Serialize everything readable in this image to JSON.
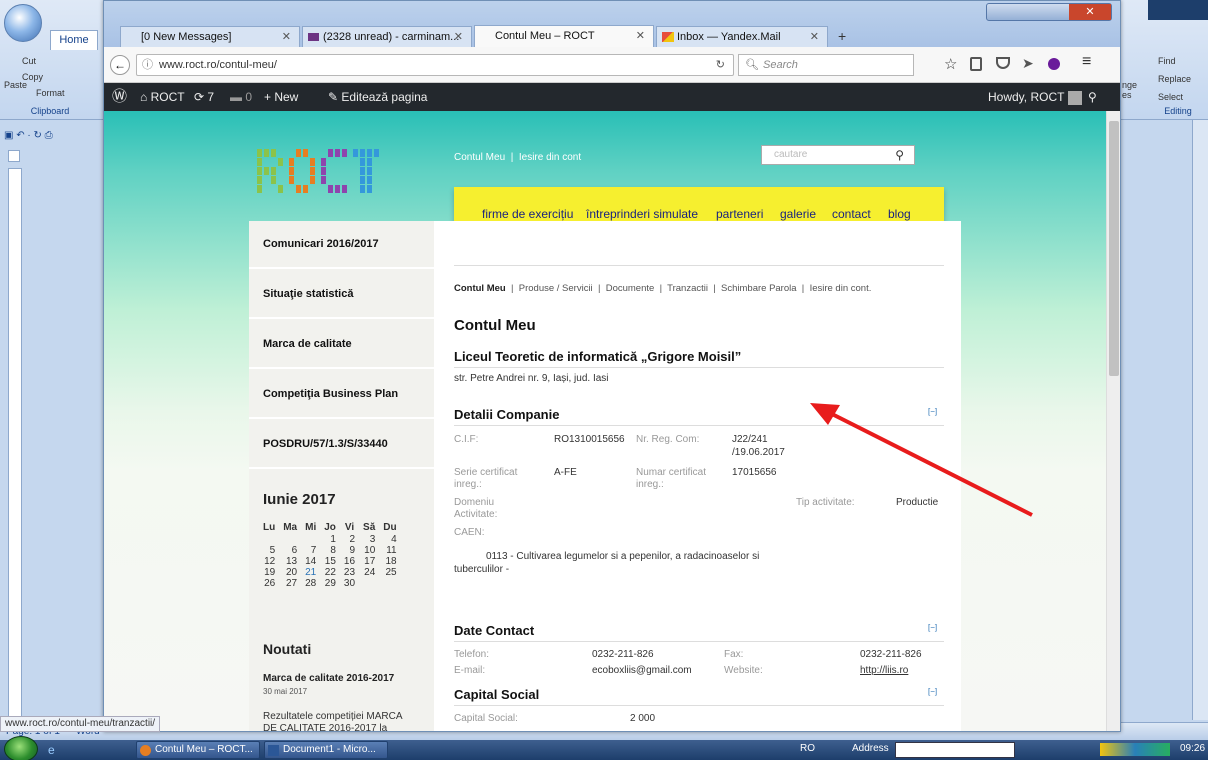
{
  "word": {
    "home_tab": "Home",
    "clipboard": {
      "cut": "Cut",
      "copy": "Copy",
      "paste": "Paste",
      "format": "Format",
      "group": "Clipboard"
    },
    "editing": {
      "find": "Find",
      "replace": "Replace",
      "select": "Select",
      "group": "Editing",
      "change": "nge",
      "styles": "es"
    },
    "status_page": "Page: 1 of 1",
    "status_words": "Word"
  },
  "browser": {
    "tabs": [
      {
        "label": "[0 New Messages]"
      },
      {
        "label": "(2328 unread) - carminam..."
      },
      {
        "label": "Contul Meu – ROCT"
      },
      {
        "label": "Inbox — Yandex.Mail"
      }
    ],
    "active_tab": 2,
    "new_tab": "+",
    "url": "www.roct.ro/contul-meu/",
    "url_domain": "roct.ro",
    "search_placeholder": "Search",
    "status_url": "www.roct.ro/contul-meu/tranzactii/"
  },
  "wpadmin": {
    "site": "ROCT",
    "updates": "7",
    "comments": "0",
    "new": "New",
    "edit": "Editează pagina",
    "howdy": "Howdy, ROCT"
  },
  "site": {
    "logo": "ROCT",
    "top_links": [
      "Contul Meu",
      "Iesire din cont"
    ],
    "search_placeholder": "cautare",
    "menu": [
      "firme de exercițiu",
      "întreprinderi simulate",
      "parteneri",
      "galerie",
      "contact",
      "blog"
    ],
    "sidebar": [
      "Comunicari 2016/2017",
      "Situaţie statistică",
      "Marca de calitate",
      "Competiţia Business Plan",
      "POSDRU/57/1.3/S/33440"
    ],
    "calendar": {
      "month": "Iunie 2017",
      "days": [
        "Lu",
        "Ma",
        "Mi",
        "Jo",
        "Vi",
        "Să",
        "Du"
      ],
      "weeks": [
        [
          "",
          "",
          "",
          "1",
          "2",
          "3",
          "4"
        ],
        [
          "5",
          "6",
          "7",
          "8",
          "9",
          "10",
          "11"
        ],
        [
          "12",
          "13",
          "14",
          "15",
          "16",
          "17",
          "18"
        ],
        [
          "19",
          "20",
          "21",
          "22",
          "23",
          "24",
          "25"
        ],
        [
          "26",
          "27",
          "28",
          "29",
          "30",
          "",
          ""
        ]
      ],
      "today": "21"
    },
    "news": {
      "title": "Noutati",
      "item_title": "Marca de calitate 2016-2017",
      "item_date": "30 mai 2017",
      "item_text1": "Rezultatele competiției MARCA",
      "item_text2": "DE CALITATE 2016-2017 la"
    },
    "account_nav": [
      "Contul Meu",
      "Produse / Servicii",
      "Documente",
      "Tranzactii",
      "Schimbare Parola",
      "Iesire din cont."
    ],
    "page_title": "Contul Meu",
    "school": "Liceul Teoretic de informatică „Grigore Moisil”",
    "address": "str. Petre Andrei nr. 9, Iași, jud. Iasi",
    "company": {
      "title": "Detalii Companie",
      "toggle": "[−]",
      "cif_label": "C.I.F:",
      "cif": "RO1310015656",
      "reg_label": "Nr. Reg. Com:",
      "reg1": "J22/241",
      "reg2": "/19.06.2017",
      "serie_label1": "Serie certificat",
      "serie_label2": "inreg.:",
      "serie": "A-FE",
      "nr_label1": "Numar certificat",
      "nr_label2": "inreg.:",
      "nr": "17015656",
      "domeniu_label1": "Domeniu",
      "domeniu_label2": "Activitate:",
      "tip_label": "Tip activitate:",
      "tip": "Productie",
      "caen_label": "CAEN:",
      "caen1": "0113 - Cultivarea legumelor si a pepenilor, a radacinoaselor si",
      "caen2": "tuberculilor -"
    },
    "contact": {
      "title": "Date Contact",
      "toggle": "[−]",
      "tel_label": "Telefon:",
      "tel": "0232-211-826",
      "fax_label": "Fax:",
      "fax": "0232-211-826",
      "email_label": "E-mail:",
      "email": "ecoboxliis@gmail.com",
      "web_label": "Website:",
      "web": "http://liis.ro"
    },
    "capital": {
      "title": "Capital Social",
      "toggle": "[−]",
      "label": "Capital Social:",
      "value": "2 000"
    }
  },
  "taskbar": {
    "items": [
      "Contul Meu – ROCT...",
      "Document1 - Micro..."
    ],
    "lang": "RO",
    "address": "Address",
    "clock": "09:26"
  },
  "colors": {
    "arrow": "#e81c1c",
    "menu": "#f6ef2f",
    "wpbar": "#23282d"
  }
}
